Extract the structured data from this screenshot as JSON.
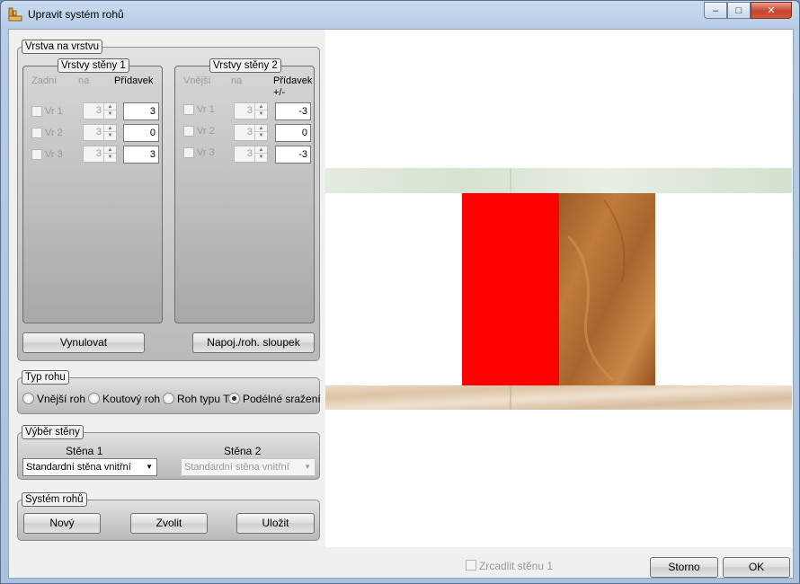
{
  "window": {
    "title": "Upravit systém rohů",
    "minimize": "‒",
    "maximize": "□",
    "close": "✕"
  },
  "layer_group": {
    "title": "Vrstva na vrstvu",
    "wall1": {
      "title": "Vrstvy stěny 1",
      "headers": {
        "side": "Zadní",
        "on": "na",
        "addition": "Přídavek"
      },
      "rows": [
        {
          "label": "Vr 1",
          "spin": "3",
          "value": "3"
        },
        {
          "label": "Vr 2",
          "spin": "3",
          "value": "0"
        },
        {
          "label": "Vr 3",
          "spin": "3",
          "value": "3"
        }
      ]
    },
    "wall2": {
      "title": "Vrstvy stěny 2",
      "headers": {
        "side": "Vnější",
        "on": "na",
        "addition": "Přídavek",
        "addition2": "+/-"
      },
      "rows": [
        {
          "label": "Vr 1",
          "spin": "3",
          "value": "-3"
        },
        {
          "label": "Vr 2",
          "spin": "3",
          "value": "0"
        },
        {
          "label": "Vr 3",
          "spin": "3",
          "value": "-3"
        }
      ]
    },
    "reset_button": "Vynulovat",
    "post_button": "Napoj./roh. sloupek"
  },
  "corner_type": {
    "title": "Typ rohu",
    "options": [
      "Vnější roh",
      "Koutový roh",
      "Roh typu T",
      "Podélné sražení"
    ],
    "selected": "Podélné sražení"
  },
  "wall_select": {
    "title": "Výběr stěny",
    "wall1_label": "Stěna 1",
    "wall2_label": "Stěna 2",
    "wall1_value": "Standardní stěna vnitřní",
    "wall2_value": "Standardní stěna vnitřní"
  },
  "corner_system": {
    "title": "Systém rohů",
    "new_button": "Nový",
    "choose_button": "Zvolit",
    "save_button": "Uložit"
  },
  "footer": {
    "mirror_label": "Zrcadlit stěnu 1",
    "cancel_button": "Storno",
    "ok_button": "OK"
  },
  "colors": {
    "highlight_layer": "#ff0000",
    "wood": "#a8642c",
    "osb": "#e6d5c0",
    "plaster": "#dfe9df"
  }
}
